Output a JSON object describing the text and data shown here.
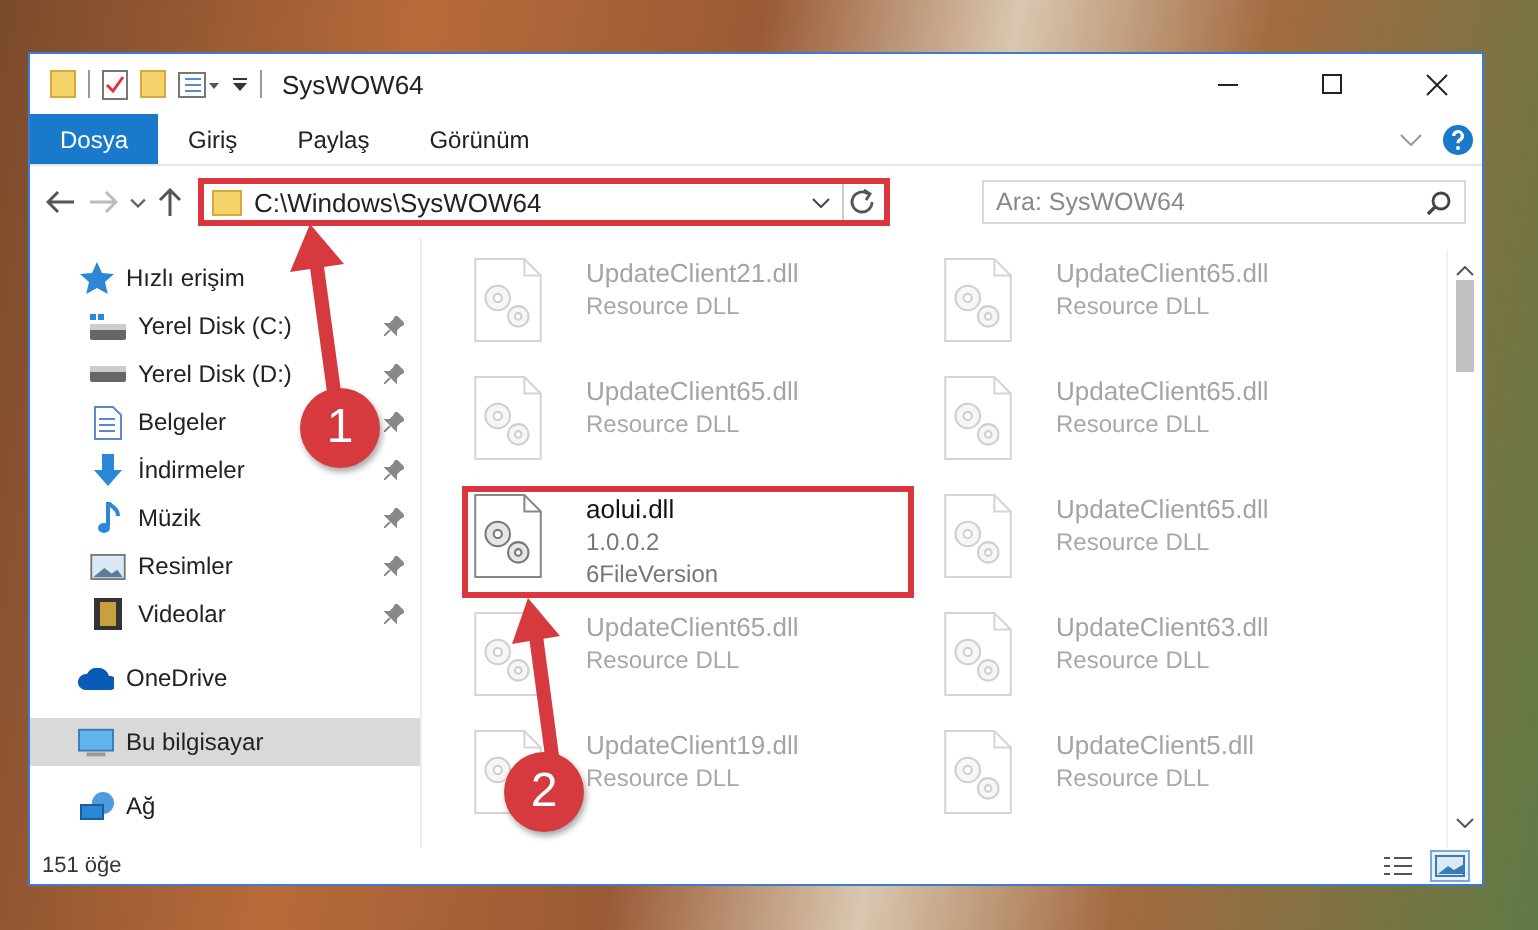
{
  "window": {
    "title": "SysWOW64"
  },
  "ribbon_tabs": [
    {
      "label": "Dosya",
      "selected": true
    },
    {
      "label": "Giriş",
      "selected": false
    },
    {
      "label": "Paylaş",
      "selected": false
    },
    {
      "label": "Görünüm",
      "selected": false
    }
  ],
  "address": {
    "path": "C:\\Windows\\SysWOW64",
    "annotated": true
  },
  "search": {
    "placeholder": "Ara: SysWOW64"
  },
  "sidebar": {
    "items": [
      {
        "label": "Hızlı erişim",
        "kind": "quick-access",
        "selected": false,
        "children": [
          {
            "label": "Yerel Disk (C:)",
            "kind": "system-drive",
            "pinned": true,
            "selected": false
          },
          {
            "label": "Yerel Disk (D:)",
            "kind": "drive",
            "pinned": true,
            "selected": false
          },
          {
            "label": "Belgeler",
            "kind": "documents",
            "pinned": true,
            "selected": false
          },
          {
            "label": "İndirmeler",
            "kind": "downloads",
            "pinned": true,
            "selected": false
          },
          {
            "label": "Müzik",
            "kind": "music",
            "pinned": true,
            "selected": false
          },
          {
            "label": "Resimler",
            "kind": "pictures",
            "pinned": true,
            "selected": false
          },
          {
            "label": "Videolar",
            "kind": "videos",
            "pinned": true,
            "selected": false
          }
        ]
      },
      {
        "label": "OneDrive",
        "kind": "cloud",
        "selected": false
      },
      {
        "label": "Bu bilgisayar",
        "kind": "computer",
        "selected": true
      },
      {
        "label": "Ağ",
        "kind": "network",
        "selected": false
      }
    ]
  },
  "files": [
    {
      "name": "UpdateClient21.dll",
      "lines": [
        "Resource DLL"
      ],
      "blurred": true,
      "annotated": false
    },
    {
      "name": "UpdateClient65.dll",
      "lines": [
        "Resource DLL"
      ],
      "blurred": true,
      "annotated": false
    },
    {
      "name": "UpdateClient65.dll",
      "lines": [
        "Resource DLL"
      ],
      "blurred": true,
      "annotated": false
    },
    {
      "name": "UpdateClient65.dll",
      "lines": [
        "Resource DLL"
      ],
      "blurred": true,
      "annotated": false
    },
    {
      "name": "aolui.dll",
      "lines": [
        "1.0.0.2",
        "6FileVersion"
      ],
      "blurred": false,
      "annotated": true
    },
    {
      "name": "UpdateClient65.dll",
      "lines": [
        "Resource DLL"
      ],
      "blurred": true,
      "annotated": false
    },
    {
      "name": "UpdateClient65.dll",
      "lines": [
        "Resource DLL"
      ],
      "blurred": true,
      "annotated": false
    },
    {
      "name": "UpdateClient63.dll",
      "lines": [
        "Resource DLL"
      ],
      "blurred": true,
      "annotated": false
    },
    {
      "name": "UpdateClient19.dll",
      "lines": [
        "Resource DLL"
      ],
      "blurred": true,
      "annotated": false
    },
    {
      "name": "UpdateClient5.dll",
      "lines": [
        "Resource DLL"
      ],
      "blurred": true,
      "annotated": false
    }
  ],
  "status_bar": {
    "count": "151 öğe",
    "views": [
      {
        "kind": "details",
        "selected": false
      },
      {
        "kind": "large-icons",
        "selected": true
      }
    ]
  },
  "annotations": [
    {
      "number": "1"
    },
    {
      "number": "2"
    }
  ]
}
